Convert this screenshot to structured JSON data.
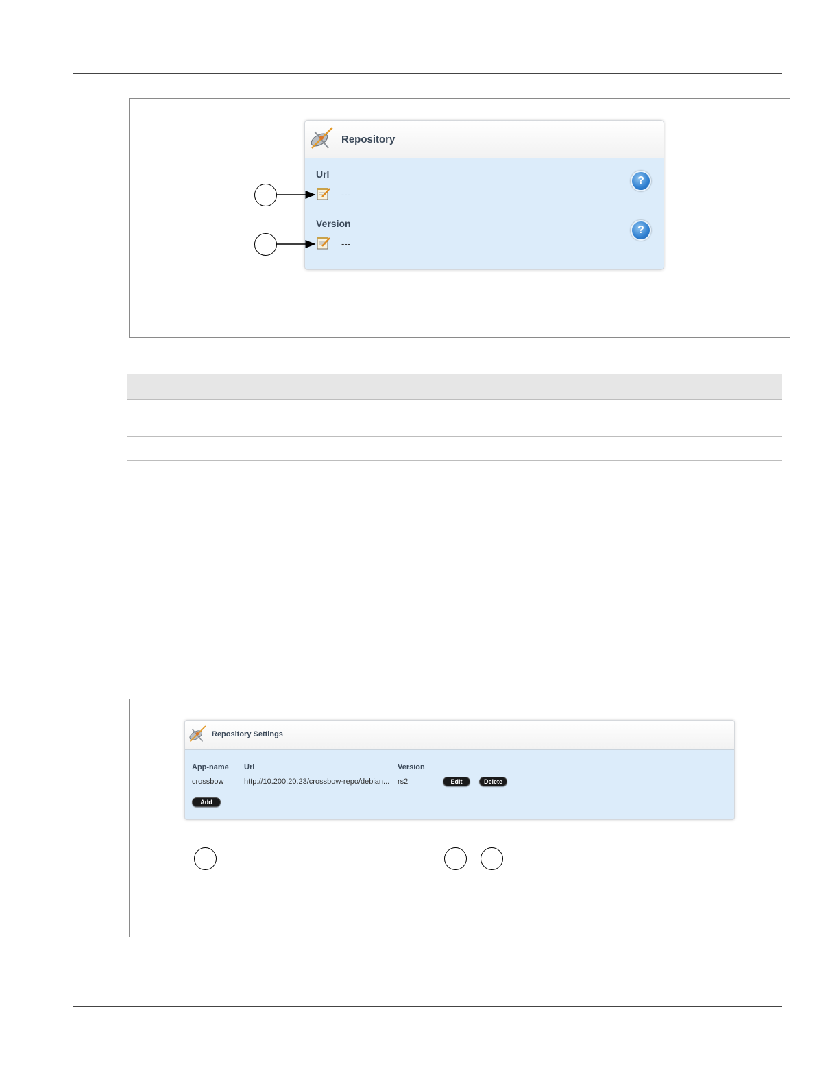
{
  "repository_panel": {
    "title": "Repository",
    "fields": [
      {
        "label": "Url",
        "value": "---"
      },
      {
        "label": "Version",
        "value": "---"
      }
    ],
    "help_glyph": "?"
  },
  "settings_panel": {
    "title": "Repository Settings",
    "columns": [
      "App-name",
      "Url",
      "Version"
    ],
    "rows": [
      {
        "app_name": "crossbow",
        "url": "http://10.200.20.23/crossbow-repo/debian...",
        "version": "rs2"
      }
    ],
    "edit_label": "Edit",
    "delete_label": "Delete",
    "add_label": "Add"
  },
  "icons": {
    "panel": "satellite-dish-icon",
    "edit": "notepad-edit-icon",
    "help": "help-icon"
  },
  "colors": {
    "panel_body": "#dcecfa",
    "panel_title": "#3c4a5a",
    "button": "#1a1a1a"
  }
}
